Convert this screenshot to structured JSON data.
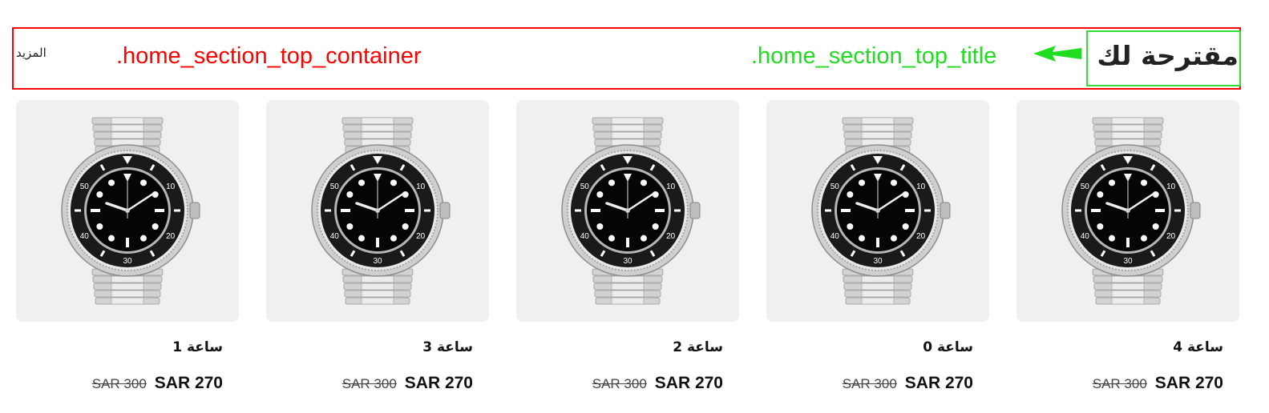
{
  "header": {
    "title": "مقترحة لك",
    "more_label": "المزيد",
    "title_annotation": ".home_section_top_title",
    "container_annotation": ".home_section_top_container"
  },
  "colors": {
    "container_outline": "#ff0000",
    "title_outline": "#33dd33",
    "annotation_arrow": "#1fdd1f",
    "card_background": "#f0f0f0"
  },
  "products": [
    {
      "name": "ساعة 1",
      "old_price": "SAR 300",
      "price": "SAR 270",
      "image_icon": "wristwatch-image"
    },
    {
      "name": "ساعة 3",
      "old_price": "SAR 300",
      "price": "SAR 270",
      "image_icon": "wristwatch-image"
    },
    {
      "name": "ساعة 2",
      "old_price": "SAR 300",
      "price": "SAR 270",
      "image_icon": "wristwatch-image"
    },
    {
      "name": "ساعة 0",
      "old_price": "SAR 300",
      "price": "SAR 270",
      "image_icon": "wristwatch-image"
    },
    {
      "name": "ساعة 4",
      "old_price": "SAR 300",
      "price": "SAR 270",
      "image_icon": "wristwatch-image"
    }
  ]
}
